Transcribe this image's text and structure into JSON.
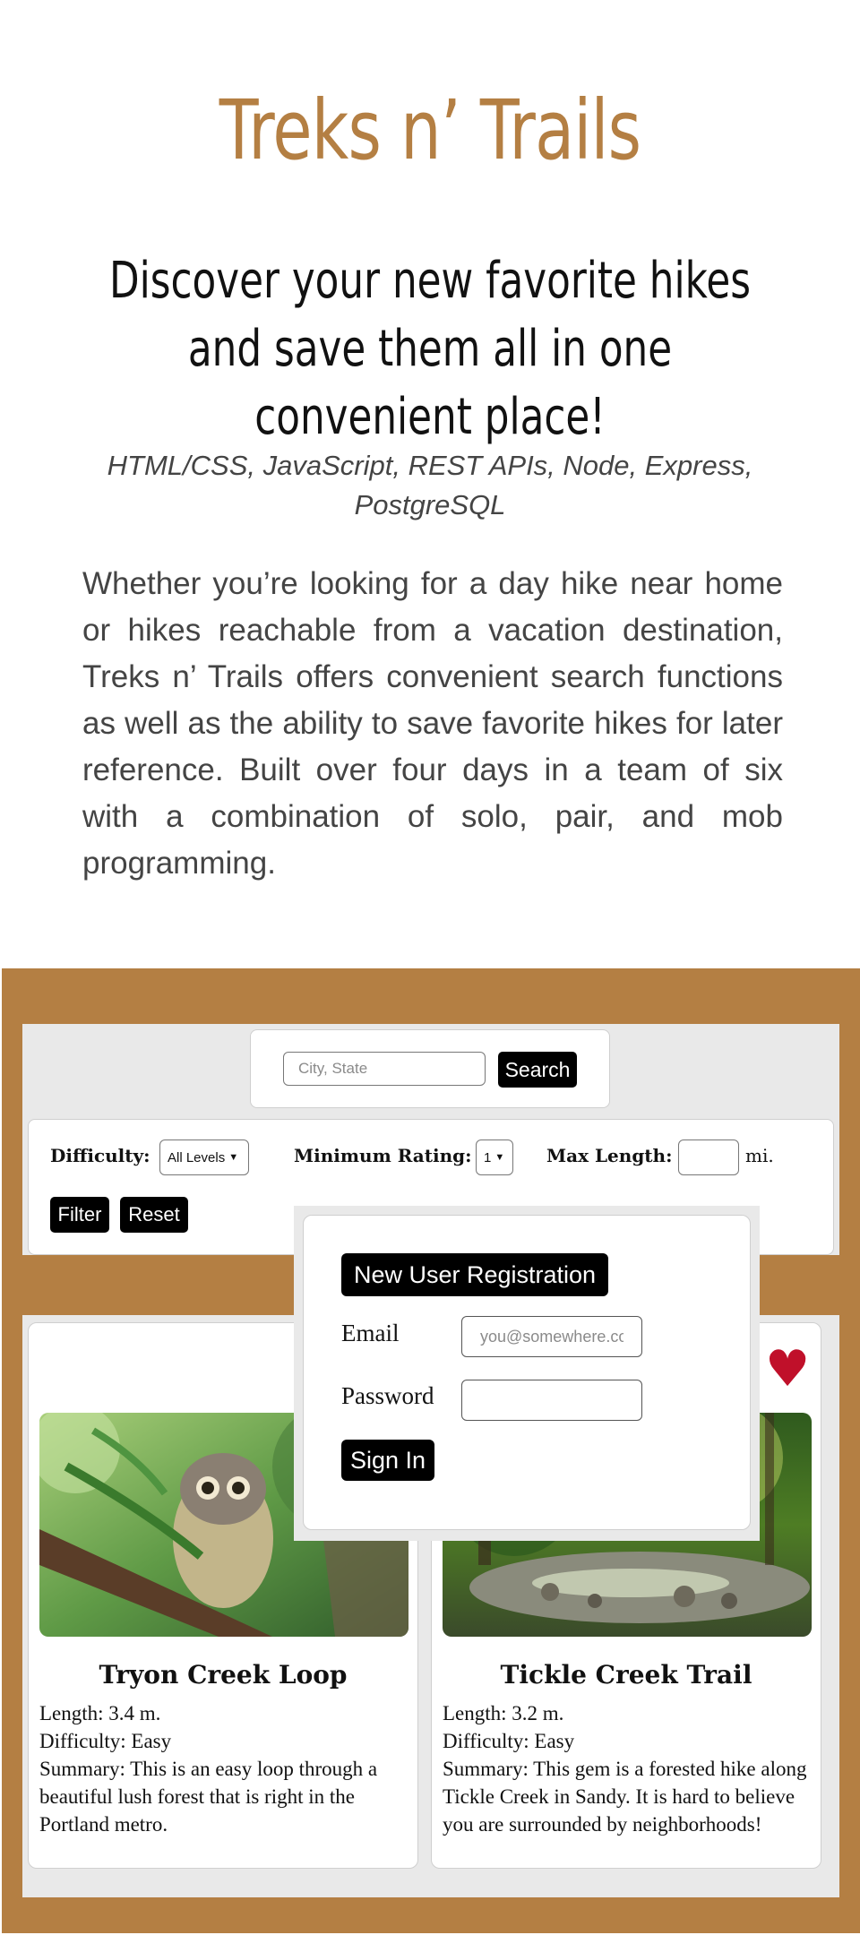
{
  "header": {
    "title": "Treks n’ Trails",
    "tagline": "Discover your new favorite hikes and save them all in one convenient place!",
    "stack": "HTML/CSS, JavaScript, REST APIs, Node, Express, PostgreSQL",
    "description": "Whether you’re looking for a day hike near home or hikes reachable from a vacation destination, Treks n’ Trails offers convenient search functions as well as the ability to save favorite hikes for later reference. Built over four days in a team of six with a combination of solo, pair, and mob programming."
  },
  "search": {
    "placeholder": "City, State",
    "button_label": "Search"
  },
  "filters": {
    "difficulty_label": "Difficulty:",
    "difficulty_value": "All Levels",
    "rating_label": "Minimum Rating:",
    "rating_value": "1",
    "length_label": "Max Length:",
    "length_unit": "mi.",
    "filter_label": "Filter",
    "reset_label": "Reset"
  },
  "trails": [
    {
      "name": "Tryon Creek Loop",
      "length": "Length: 3.4 m.",
      "difficulty": "Difficulty: Easy",
      "summary": "Summary: This is an easy loop through a beautiful lush forest that is right in the Portland metro."
    },
    {
      "name": "Tickle Creek Trail",
      "length": "Length: 3.2 m.",
      "difficulty": "Difficulty: Easy",
      "summary": "Summary: This gem is a forested hike along Tickle Creek in Sandy. It is hard to believe you are surrounded by neighborhoods!",
      "favorite_icon": "heart-icon"
    }
  ],
  "login": {
    "register_label": "New User Registration",
    "email_label": "Email",
    "email_placeholder": "you@somewhere.com",
    "password_label": "Password",
    "signin_label": "Sign In"
  },
  "colors": {
    "brand": "#b47f43",
    "panel": "#e9e9e9",
    "button": "#000000",
    "heart": "#c0102a"
  }
}
